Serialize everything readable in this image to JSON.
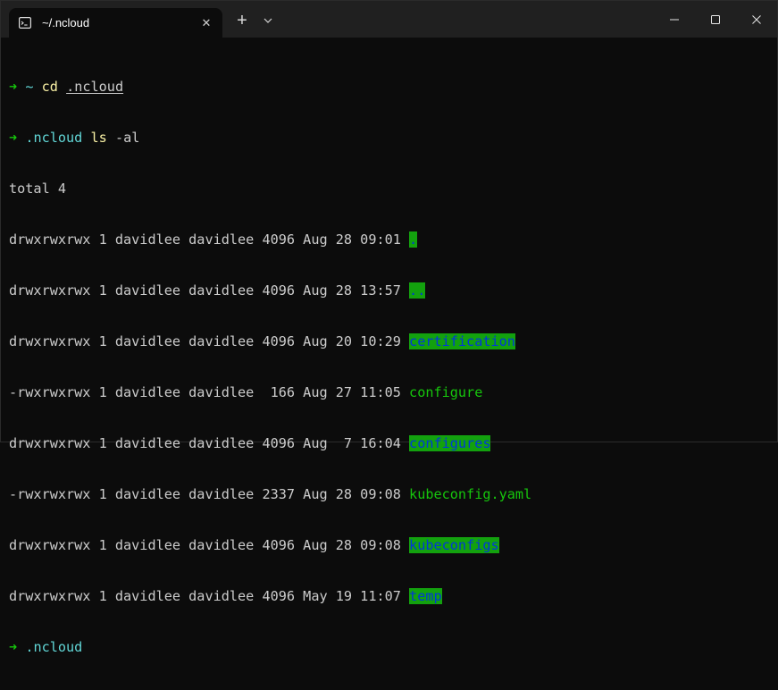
{
  "window": {
    "tab_title": "~/.ncloud",
    "tab_icon": "terminal-icon",
    "tab_close": "✕",
    "new_tab": "+",
    "colors": {
      "titlebar": "#202020",
      "background": "#0c0c0c",
      "prompt_arrow": "#16c60c",
      "cwd": "#61d6d6",
      "command": "#f9f1a5",
      "dir_highlight_bg": "#13a10e",
      "dir_highlight_fg": "#0037da"
    }
  },
  "terminal": {
    "lines": [
      {
        "type": "prompt",
        "arrow": "➜",
        "cwd": "~",
        "cmd": "cd",
        "arg": ".ncloud"
      },
      {
        "type": "prompt",
        "arrow": "➜",
        "cwd": ".ncloud",
        "cmd": "ls",
        "arg": "-al"
      },
      {
        "type": "text",
        "text": "total 4"
      },
      {
        "type": "entry",
        "meta": "drwxrwxrwx 1 davidlee davidlee 4096 Aug 28 09:01 ",
        "name": ".",
        "kind": "dir"
      },
      {
        "type": "entry",
        "meta": "drwxrwxrwx 1 davidlee davidlee 4096 Aug 28 13:57 ",
        "name": "..",
        "kind": "dir"
      },
      {
        "type": "entry",
        "meta": "drwxrwxrwx 1 davidlee davidlee 4096 Aug 20 10:29 ",
        "name": "certification",
        "kind": "dir"
      },
      {
        "type": "entry",
        "meta": "-rwxrwxrwx 1 davidlee davidlee  166 Aug 27 11:05 ",
        "name": "configure",
        "kind": "file"
      },
      {
        "type": "entry",
        "meta": "drwxrwxrwx 1 davidlee davidlee 4096 Aug  7 16:04 ",
        "name": "configures",
        "kind": "dir"
      },
      {
        "type": "entry",
        "meta": "-rwxrwxrwx 1 davidlee davidlee 2337 Aug 28 09:08 ",
        "name": "kubeconfig.yaml",
        "kind": "file"
      },
      {
        "type": "entry",
        "meta": "drwxrwxrwx 1 davidlee davidlee 4096 Aug 28 09:08 ",
        "name": "kubeconfigs",
        "kind": "dir"
      },
      {
        "type": "entry",
        "meta": "drwxrwxrwx 1 davidlee davidlee 4096 May 19 11:07 ",
        "name": "temp",
        "kind": "dir"
      },
      {
        "type": "prompt_empty",
        "arrow": "➜",
        "cwd": ".ncloud"
      }
    ]
  }
}
